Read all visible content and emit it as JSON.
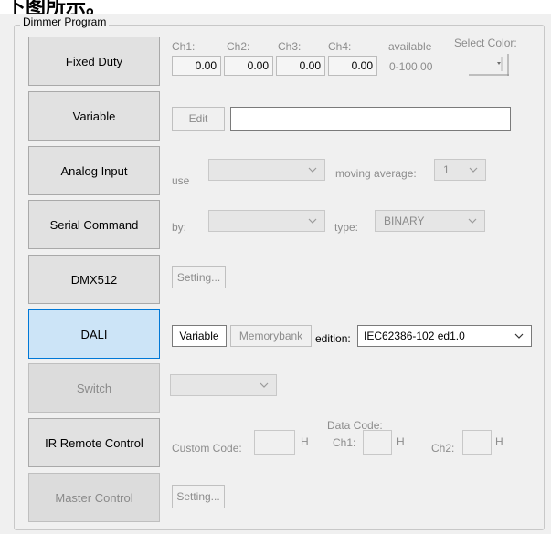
{
  "top_strip_text": "下图所示。",
  "group": {
    "title": "Dimmer Program"
  },
  "program_buttons": [
    {
      "label": "Fixed Duty"
    },
    {
      "label": "Variable"
    },
    {
      "label": "Analog Input"
    },
    {
      "label": "Serial Command"
    },
    {
      "label": "DMX512"
    },
    {
      "label": "DALI"
    },
    {
      "label": "Switch"
    },
    {
      "label": "IR Remote Control"
    },
    {
      "label": "Master Control"
    }
  ],
  "fixed_duty": {
    "channels": [
      {
        "label": "Ch1:",
        "value": "0.00"
      },
      {
        "label": "Ch2:",
        "value": "0.00"
      },
      {
        "label": "Ch3:",
        "value": "0.00"
      },
      {
        "label": "Ch4:",
        "value": "0.00"
      }
    ],
    "available_label": "available",
    "available_range": "0-100.00",
    "select_color_label": "Select Color:"
  },
  "variable": {
    "edit_label": "Edit",
    "text_value": ""
  },
  "analog_input": {
    "use_label": "use",
    "use_value": "",
    "moving_average_label": "moving average:",
    "moving_average_value": "1"
  },
  "serial_command": {
    "by_label": "by:",
    "by_value": "",
    "type_label": "type:",
    "type_value": "BINARY"
  },
  "dmx512": {
    "setting_label": "Setting..."
  },
  "dali": {
    "variable_label": "Variable",
    "memorybank_label": "Memorybank",
    "edition_label": "edition:",
    "edition_value": "IEC62386-102 ed1.0"
  },
  "switch": {
    "value": ""
  },
  "ir_remote": {
    "custom_code_label": "Custom Code:",
    "data_code_label": "Data Code:",
    "ch1_label": "Ch1:",
    "ch2_label": "Ch2:",
    "hex_suffix": "H"
  },
  "master_control": {
    "setting_label": "Setting..."
  }
}
